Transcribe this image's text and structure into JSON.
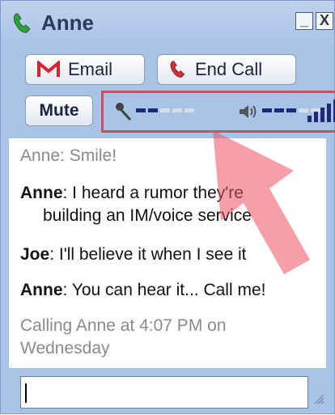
{
  "window": {
    "title": "Anne",
    "minimize_label": "_",
    "close_label": "X"
  },
  "toolbar": {
    "email_label": "Email",
    "endcall_label": "End Call",
    "mute_label": "Mute"
  },
  "audio": {
    "mic_level": 0.4,
    "speaker_level": 0.6,
    "signal_strength": 1.0
  },
  "chat": {
    "messages": [
      {
        "type": "status",
        "text": "Anne: Smile!"
      },
      {
        "type": "message",
        "sender": "Anne",
        "line1": ": I heard a rumor they're",
        "line2": "building an IM/voice service"
      },
      {
        "type": "message",
        "sender": "Joe",
        "line1": ": I'll believe it when I see it"
      },
      {
        "type": "message",
        "sender": "Anne",
        "line1": ": You can hear it... Call me!"
      },
      {
        "type": "status",
        "text": "Calling Anne at 4:07 PM on Wednesday"
      }
    ]
  },
  "input": {
    "value": ""
  },
  "colors": {
    "accent_highlight": "#d14a68",
    "level_on": "#1c2a78",
    "phone_green": "#2e9e3e",
    "phone_red": "#c8323c"
  }
}
